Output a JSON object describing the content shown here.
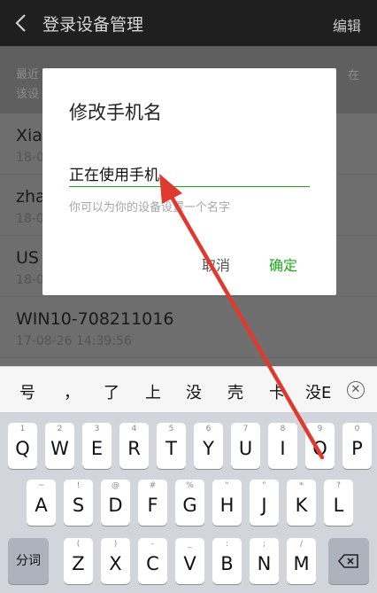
{
  "header": {
    "title": "登录设备管理",
    "edit_label": "编辑"
  },
  "hint": {
    "line1": "最近",
    "line2": "该设",
    "right_fragment": "在"
  },
  "devices": [
    {
      "name": "Xia",
      "time": "18-0"
    },
    {
      "name": "zha",
      "time": "18-0"
    },
    {
      "name": "US",
      "time": "18-0"
    },
    {
      "name": "WIN10-708211016",
      "time": "17-08-26 14:39:56"
    }
  ],
  "dialog": {
    "title": "修改手机名",
    "input_value": "正在使用手机",
    "hint": "你可以为你的设备设置一个名字",
    "cancel_label": "取消",
    "confirm_label": "确定"
  },
  "candidates": [
    "号",
    "，",
    "了",
    "上",
    "没",
    "壳",
    "卡",
    "没E"
  ],
  "keyboard": {
    "row1": [
      {
        "main": "Q",
        "sub": "1"
      },
      {
        "main": "W",
        "sub": "2"
      },
      {
        "main": "E",
        "sub": "3"
      },
      {
        "main": "R",
        "sub": "4"
      },
      {
        "main": "T",
        "sub": "5"
      },
      {
        "main": "Y",
        "sub": "6"
      },
      {
        "main": "U",
        "sub": "7"
      },
      {
        "main": "I",
        "sub": "8"
      },
      {
        "main": "O",
        "sub": "9"
      },
      {
        "main": "P",
        "sub": "0"
      }
    ],
    "row2": [
      {
        "main": "A",
        "sub": "~"
      },
      {
        "main": "S",
        "sub": "!"
      },
      {
        "main": "D",
        "sub": "@"
      },
      {
        "main": "F",
        "sub": "#"
      },
      {
        "main": "G",
        "sub": "%"
      },
      {
        "main": "H",
        "sub": "\""
      },
      {
        "main": "J",
        "sub": "\""
      },
      {
        "main": "K",
        "sub": "*"
      },
      {
        "main": "L",
        "sub": "?"
      }
    ],
    "row3": [
      {
        "main": "Z",
        "sub": "("
      },
      {
        "main": "X",
        "sub": ")"
      },
      {
        "main": "C",
        "sub": "-"
      },
      {
        "main": "V",
        "sub": "_"
      },
      {
        "main": "B",
        "sub": ":"
      },
      {
        "main": "N",
        "sub": ";"
      },
      {
        "main": "M",
        "sub": "/"
      }
    ],
    "segment_label": "分词"
  },
  "colors": {
    "accent": "#1aad19",
    "annotation_arrow": "#e03a2f"
  }
}
